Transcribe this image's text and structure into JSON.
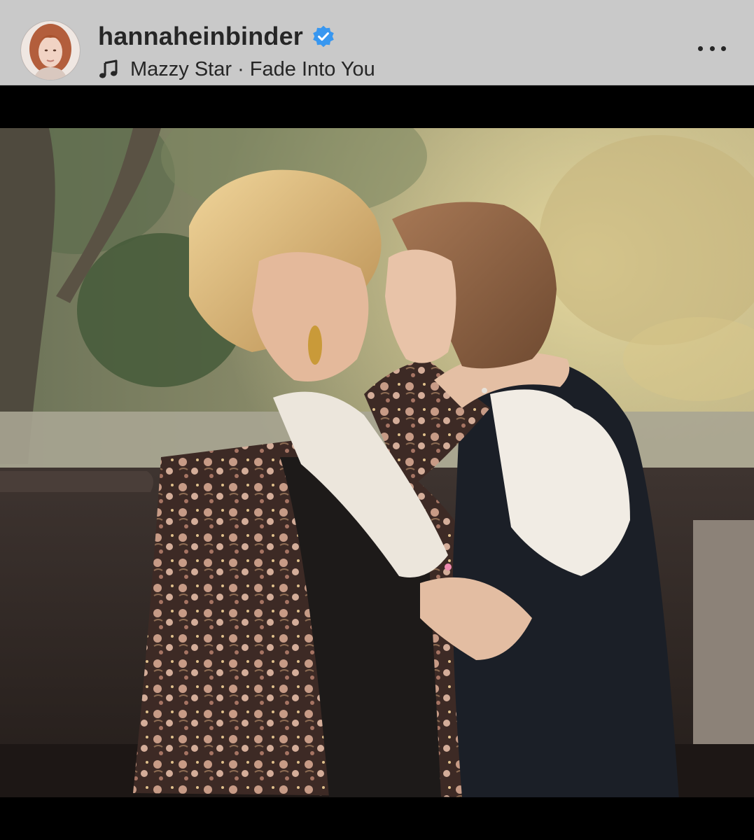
{
  "post": {
    "username": "hannaheinbinder",
    "verified": true,
    "audio": "Mazzy Star · Fade Into You"
  },
  "icons": {
    "verified": "verified-badge-icon",
    "music": "music-note-icon",
    "more": "more-options-icon"
  },
  "colors": {
    "header_background": "#c9c9c9",
    "verified_blue": "#3897f0",
    "text": "#262626",
    "letterbox": "#000000"
  }
}
